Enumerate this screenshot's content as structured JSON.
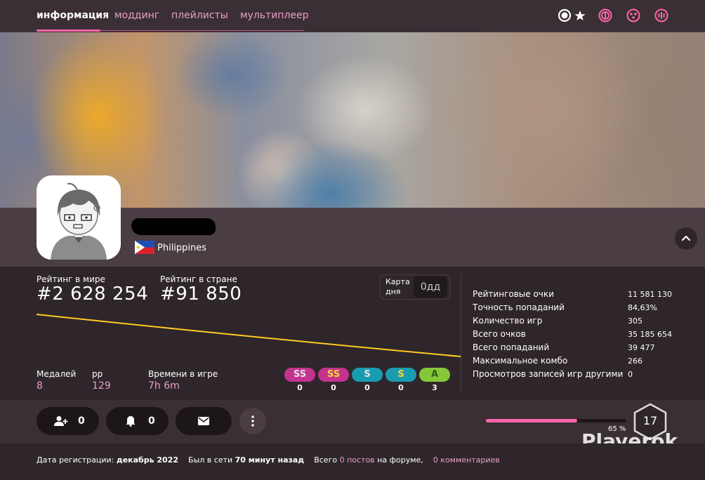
{
  "nav": {
    "tabs": [
      {
        "label": "информация",
        "active": true
      },
      {
        "label": "моддинг",
        "active": false
      },
      {
        "label": "плейлисты",
        "active": false
      },
      {
        "label": "мультиплеер",
        "active": false
      }
    ],
    "mode_icons": [
      "osu-standard-icon",
      "taiko-icon",
      "catch-icon",
      "mania-icon"
    ],
    "accent": "#ff66ab"
  },
  "profile": {
    "country": "Philippines",
    "flag": "philippines-flag-icon"
  },
  "ranks": {
    "global_label": "Рейтинг в мире",
    "global_value": "#2 628 254",
    "country_label": "Рейтинг в стране",
    "country_value": "#91 850"
  },
  "daily": {
    "label_line1": "Карта",
    "label_line2": "дня",
    "value": "0дд"
  },
  "mini_stats": [
    {
      "label": "Медалей",
      "value": "8"
    },
    {
      "label": "pp",
      "value": "129"
    },
    {
      "label": "Времени в игре",
      "value": "7h 6m"
    }
  ],
  "grades": [
    {
      "grade": "SS",
      "count": "0",
      "color": "#e5e5e5",
      "bg": "#c4338f"
    },
    {
      "grade": "SS",
      "count": "0",
      "color": "#ffd63b",
      "bg": "#c4338f"
    },
    {
      "grade": "S",
      "count": "0",
      "color": "#e5e5e5",
      "bg": "#1a9cb0"
    },
    {
      "grade": "S",
      "count": "0",
      "color": "#ffd63b",
      "bg": "#1a9cb0"
    },
    {
      "grade": "A",
      "count": "3",
      "color": "#2f5a13",
      "bg": "#86c738"
    }
  ],
  "details": [
    {
      "label": "Рейтинговые очки",
      "value": "11 581 130"
    },
    {
      "label": "Точность попаданий",
      "value": "84,63%"
    },
    {
      "label": "Количество игр",
      "value": "305"
    },
    {
      "label": "Всего очков",
      "value": "35 185 654"
    },
    {
      "label": "Всего попаданий",
      "value": "39 477"
    },
    {
      "label": "Максимальное комбо",
      "value": "266"
    },
    {
      "label": "Просмотров записей игр другими",
      "value": "0"
    }
  ],
  "actions": {
    "friends": "0",
    "followers": "0"
  },
  "level": {
    "number": "17",
    "progress_label": "65 %",
    "progress": 0.65
  },
  "watermark": "Playerok",
  "footer": {
    "joined_label": "Дата регистрации:",
    "joined_value": "декабрь 2022",
    "online_label": "Был в сети",
    "online_value": "70 минут назад",
    "forum_prefix": "Всего",
    "posts_link": "0 постов",
    "forum_suffix": "на форуме,",
    "comments_link": "0 комментариев"
  }
}
